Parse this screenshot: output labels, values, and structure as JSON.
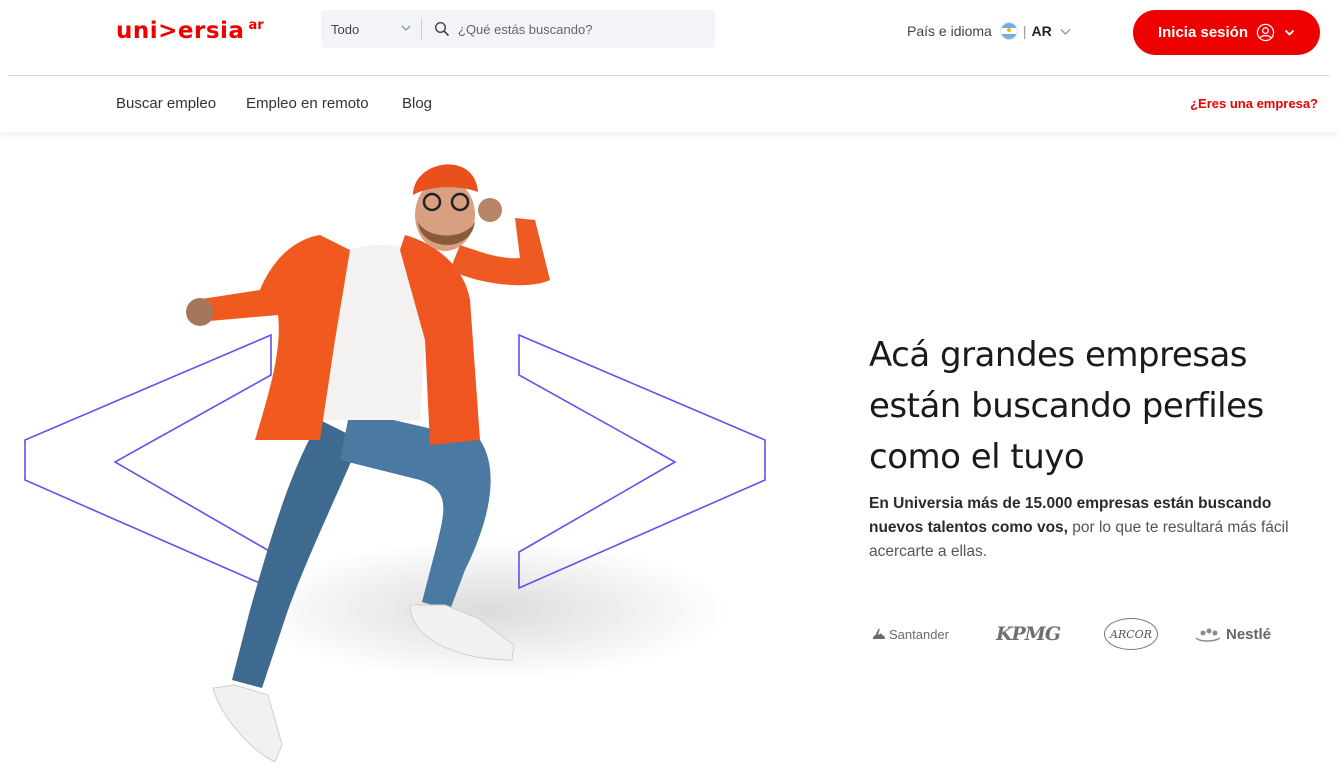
{
  "header": {
    "logo_text": "uni>ersia",
    "logo_country": "ar",
    "search": {
      "category": "Todo",
      "placeholder": "¿Qué estás buscando?"
    },
    "language": {
      "label": "País e idioma",
      "separator": "|",
      "code": "AR"
    },
    "login_label": "Inicia sesión"
  },
  "nav": {
    "items": [
      {
        "label": "Buscar empleo"
      },
      {
        "label": "Empleo en remoto"
      },
      {
        "label": "Blog"
      }
    ],
    "company_link": "¿Eres una empresa?"
  },
  "hero": {
    "headline_lines": [
      "Acá grandes empresas",
      "están buscando perfiles",
      "como el tuyo"
    ],
    "subtext_bold": "En Universia más de 15.000 empresas están buscando nuevos talentos como vos,",
    "subtext_rest": " por lo que te resultará más fácil acercarte a ellas.",
    "brands": {
      "santander": "Santander",
      "kpmg": "KPMG",
      "arcor": "ARCOR",
      "nestle": "Nestlé"
    }
  },
  "colors": {
    "brand_red": "#ec0000",
    "accent_outline": "#5a55f0",
    "jacket_orange": "#f05a1e"
  },
  "icons": [
    "chevron-down-icon",
    "search-icon",
    "argentina-flag-icon",
    "user-circle-icon"
  ]
}
